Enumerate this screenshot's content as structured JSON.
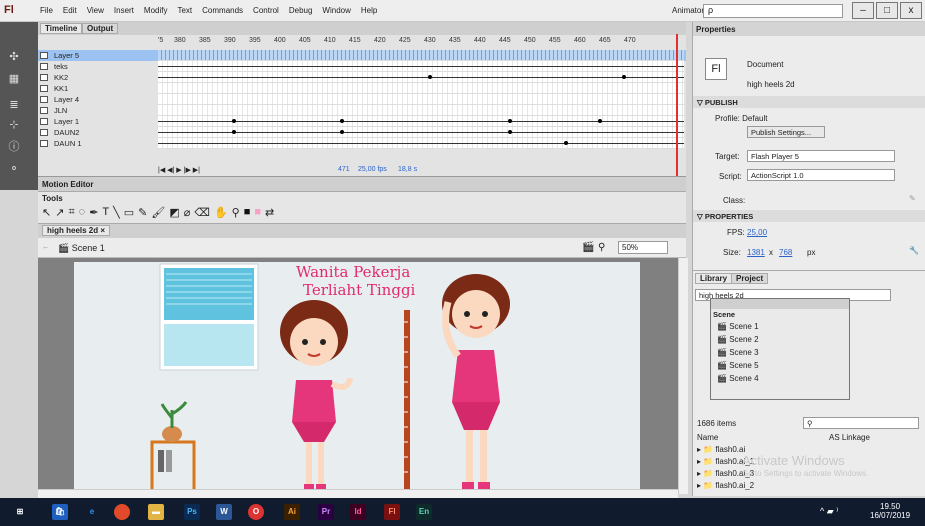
{
  "app": {
    "logo": "Fl",
    "menus": [
      "File",
      "Edit",
      "View",
      "Insert",
      "Modify",
      "Text",
      "Commands",
      "Control",
      "Debug",
      "Window",
      "Help"
    ],
    "workspace": "Animator",
    "search_placeholder": "ρ"
  },
  "window_controls": [
    "–",
    "□",
    "x"
  ],
  "timeline": {
    "tabs": [
      "Timeline",
      "Output"
    ],
    "ruler": [
      "'5",
      "380",
      "385",
      "390",
      "395",
      "400",
      "405",
      "410",
      "415",
      "420",
      "425",
      "430",
      "435",
      "440",
      "445",
      "450",
      "455",
      "460",
      "465",
      "470"
    ],
    "layers": [
      "Layer 5",
      "teks",
      "KK2",
      "KK1",
      "Layer 4",
      "JLN",
      "Layer 1",
      "DAUN2",
      "DAUN 1"
    ],
    "status": {
      "frame": "471",
      "fps": "25,00 fps",
      "time": "18,8 s"
    }
  },
  "motion_editor": {
    "label": "Motion Editor"
  },
  "tools": {
    "label": "Tools"
  },
  "document": {
    "tab": "high heels 2d",
    "scene": "Scene 1",
    "zoom": "50%"
  },
  "stage_text": {
    "title_line1": "Wanita Pekerja",
    "title_line2": "Terliaht Tinggi"
  },
  "properties": {
    "header": "Properties",
    "doc_type": "Document",
    "doc_name": "high heels 2d",
    "publish_header": "PUBLISH",
    "profile": "Profile: Default",
    "publish_settings": "Publish Settings...",
    "target_label": "Target:",
    "target": "Flash Player 5",
    "script_label": "Script:",
    "script": "ActionScript 1.0",
    "class_label": "Class:",
    "properties_header": "PROPERTIES",
    "fps_label": "FPS:",
    "fps": "25,00",
    "size_label": "Size:",
    "width": "1381",
    "x": "x",
    "height": "768",
    "unit": "px"
  },
  "library": {
    "tabs": [
      "Library",
      "Project"
    ],
    "doc": "high heels 2d",
    "scene_panel_title": "Scene",
    "scenes": [
      "Scene 1",
      "Scene 2",
      "Scene 3",
      "Scene 5",
      "Scene 4"
    ],
    "count": "1686 items",
    "col_name": "Name",
    "col_linkage": "AS Linkage",
    "items": [
      "flash0.ai",
      "flash0.ai_1",
      "flash0.ai_3",
      "flash0.ai_2"
    ]
  },
  "watermark": {
    "line1": "Activate Windows",
    "line2": "Go to Settings to activate Windows."
  },
  "taskbar": {
    "time": "19.50",
    "date": "16/07/2019",
    "apps": [
      "Ps",
      "W",
      "Ai",
      "Pr",
      "Id",
      "Fl",
      "En"
    ]
  }
}
